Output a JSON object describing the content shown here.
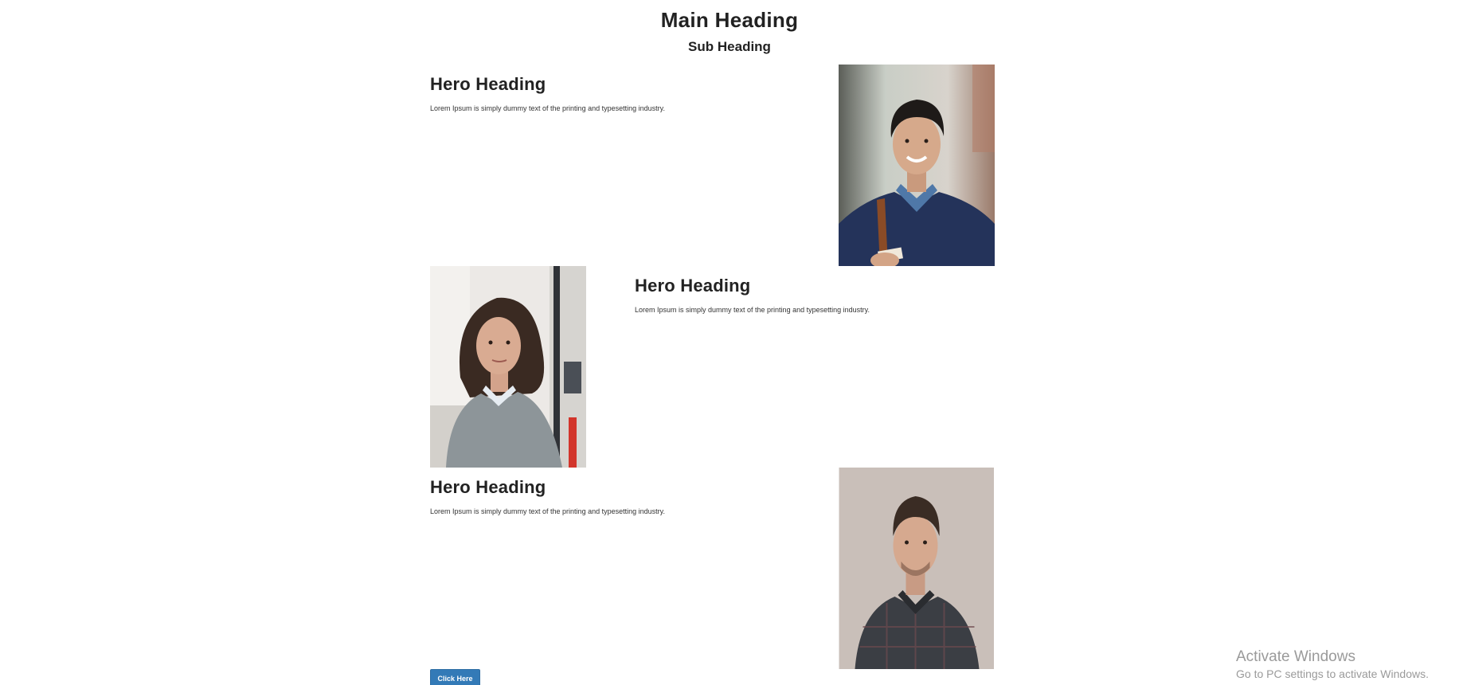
{
  "header": {
    "main_heading": "Main Heading",
    "sub_heading": "Sub Heading"
  },
  "heroes": [
    {
      "heading": "Hero Heading",
      "text": "Lorem Ipsum is simply dummy text of the printing and typesetting industry.",
      "image": "man-smiling-photo"
    },
    {
      "heading": "Hero Heading",
      "text": "Lorem Ipsum is simply dummy text of the printing and typesetting industry.",
      "image": "woman-portrait-photo"
    },
    {
      "heading": "Hero Heading",
      "text": "Lorem Ipsum is simply dummy text of the printing and typesetting industry.",
      "image": "man-portrait-photo"
    }
  ],
  "button": {
    "label": "Click Here",
    "color": "#337ab7"
  },
  "watermark": {
    "title": "Activate Windows",
    "subtitle": "Go to PC settings to activate Windows."
  }
}
